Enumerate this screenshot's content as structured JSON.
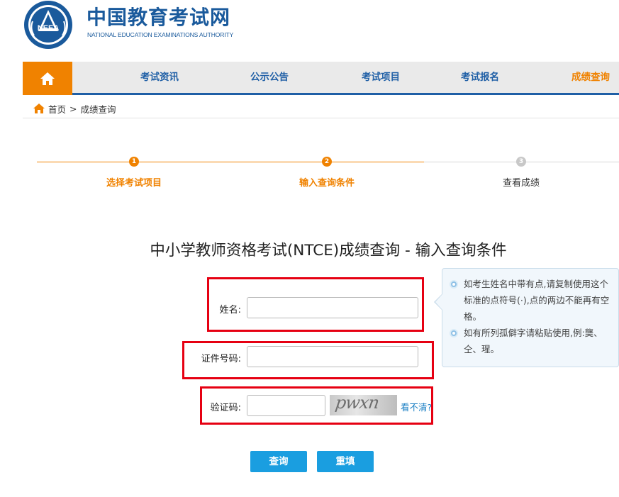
{
  "header": {
    "logo_cn": "中国教育考试网",
    "logo_en": "NATIONAL EDUCATION EXAMINATIONS AUTHORITY",
    "emblem_text": "NEEA"
  },
  "nav": {
    "home_icon": "home-icon",
    "items": [
      {
        "label": "考试资讯"
      },
      {
        "label": "公示公告"
      },
      {
        "label": "考试项目"
      },
      {
        "label": "考试报名"
      },
      {
        "label": "成绩查询"
      }
    ],
    "active_index": 4
  },
  "breadcrumb": {
    "home": "首页",
    "separator": ">",
    "current": "成绩查询"
  },
  "steps": [
    {
      "number": "1",
      "label": "选择考试项目",
      "state": "done"
    },
    {
      "number": "2",
      "label": "输入查询条件",
      "state": "current"
    },
    {
      "number": "3",
      "label": "查看成绩",
      "state": "todo"
    }
  ],
  "form": {
    "title": "中小学教师资格考试(NTCE)成绩查询 - 输入查询条件",
    "name_label": "姓名:",
    "name_value": "",
    "id_label": "证件号码:",
    "id_value": "",
    "captcha_label": "验证码:",
    "captcha_value": "",
    "captcha_image_text": "pwxn",
    "captcha_refresh": "看不清?",
    "submit": "查询",
    "reset": "重填"
  },
  "tips": [
    "如考生姓名中带有点,请复制使用这个标准的点符号(·),点的两边不能再有空格。",
    "如有所列孤僻字请粘贴使用,例:龑、仝、瑆。"
  ],
  "colors": {
    "brand_blue": "#1f5fa6",
    "accent_orange": "#f08200",
    "button_blue": "#1a9ee0",
    "highlight_red": "#e60012"
  }
}
